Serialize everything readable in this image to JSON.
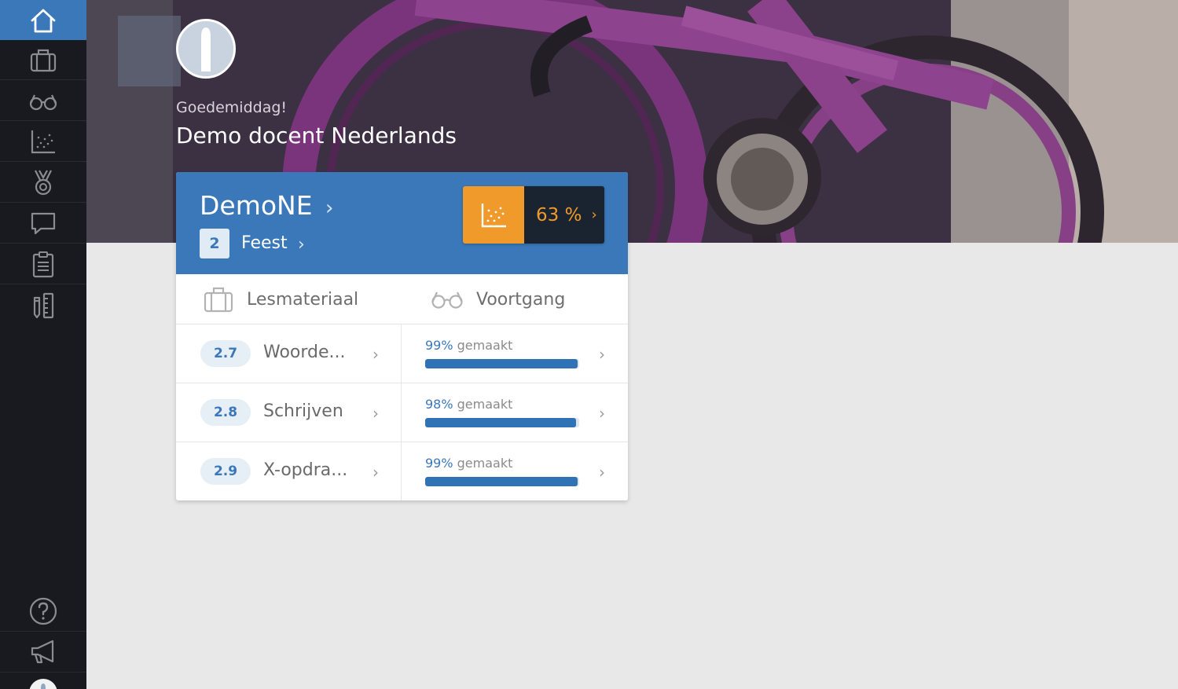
{
  "sidebar": {
    "items": [
      {
        "name": "home",
        "icon": "home-icon",
        "active": true
      },
      {
        "name": "lesmateriaal",
        "icon": "briefcase-icon"
      },
      {
        "name": "voortgang",
        "icon": "glasses-icon"
      },
      {
        "name": "statistics",
        "icon": "scatter-chart-icon"
      },
      {
        "name": "badges",
        "icon": "medal-icon"
      },
      {
        "name": "messages",
        "icon": "chat-icon"
      },
      {
        "name": "tasks",
        "icon": "clipboard-icon"
      },
      {
        "name": "tools",
        "icon": "pencil-ruler-icon"
      }
    ],
    "bottom": [
      {
        "name": "help",
        "icon": "question-icon"
      },
      {
        "name": "announcements",
        "icon": "megaphone-icon"
      }
    ]
  },
  "header": {
    "greeting": "Goedemiddag!",
    "name": "Demo docent Nederlands"
  },
  "card": {
    "course_title": "DemoNE",
    "chapter_number": "2",
    "chapter_title": "Feest",
    "stat_value": "63 %",
    "tabs": {
      "material": "Lesmateriaal",
      "progress": "Voortgang"
    },
    "rows": [
      {
        "number": "2.7",
        "title": "Woorde...",
        "percent": "99%",
        "percent_value": 99,
        "label": " gemaakt"
      },
      {
        "number": "2.8",
        "title": "Schrijven",
        "percent": "98%",
        "percent_value": 98,
        "label": " gemaakt"
      },
      {
        "number": "2.9",
        "title": "X-opdra...",
        "percent": "99%",
        "percent_value": 99,
        "label": " gemaakt"
      }
    ]
  },
  "colors": {
    "accent": "#3a78b9",
    "sidebar": "#191a1f",
    "stat_orange": "#ef9a2a",
    "stat_dark": "#1a2430"
  }
}
